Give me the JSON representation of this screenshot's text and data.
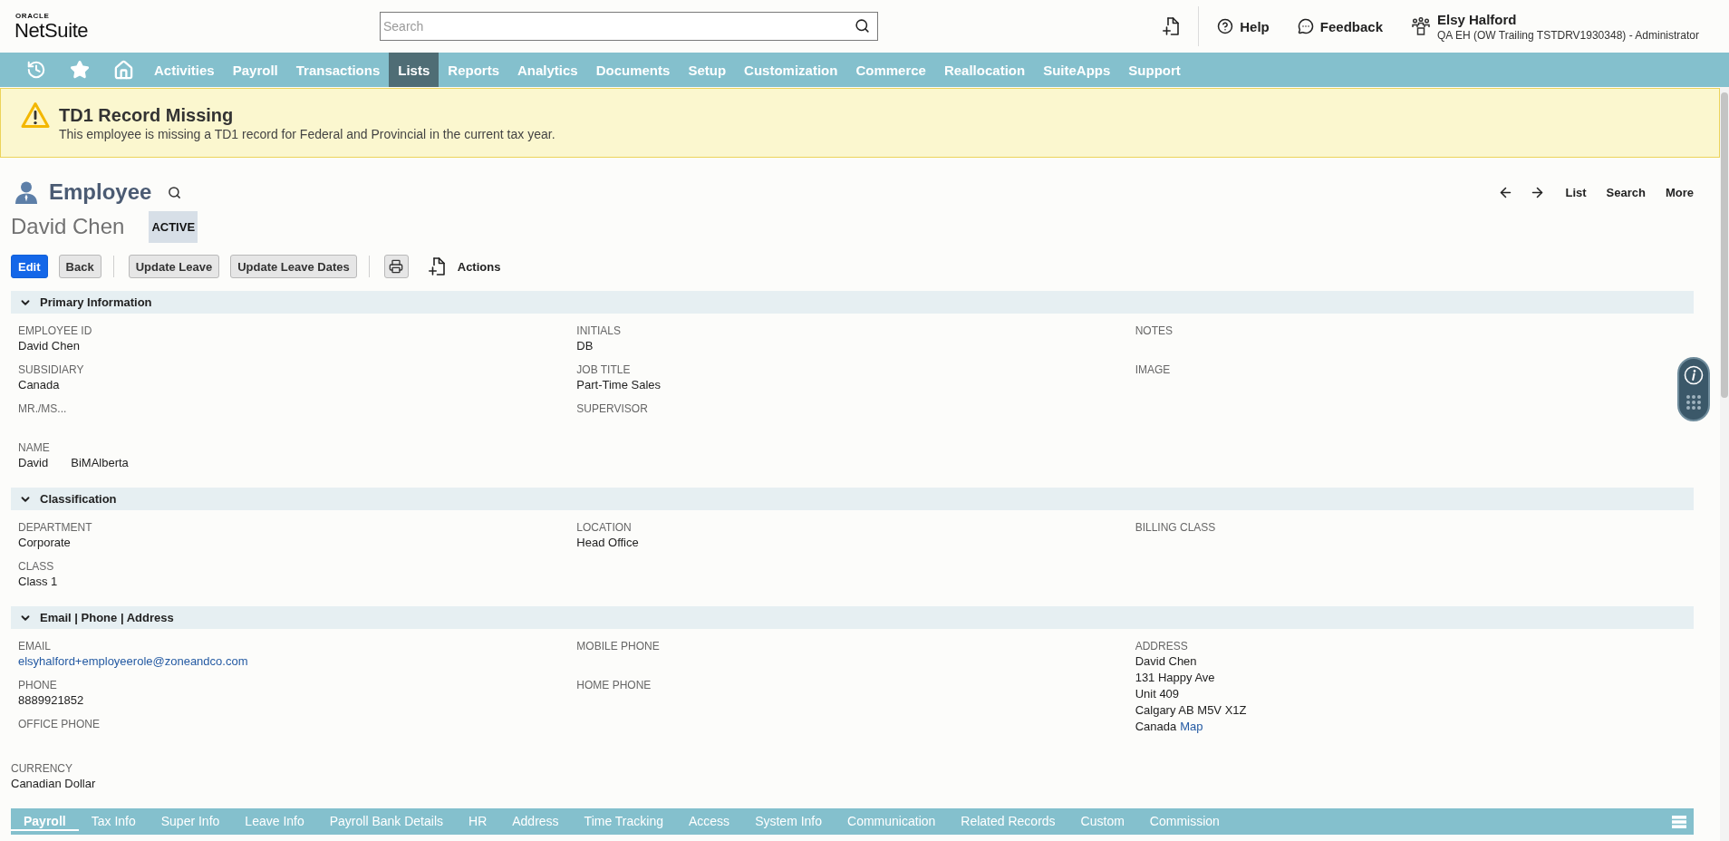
{
  "header": {
    "logo": {
      "caption": "ORACLE",
      "name": "NetSuite"
    },
    "search": {
      "placeholder": "Search"
    },
    "help": "Help",
    "feedback": "Feedback",
    "user": {
      "name": "Elsy Halford",
      "role": "QA EH (OW Trailing TSTDRV1930348) - Administrator"
    }
  },
  "nav": {
    "items": [
      {
        "label": "Activities",
        "selected": false
      },
      {
        "label": "Payroll",
        "selected": false
      },
      {
        "label": "Transactions",
        "selected": false
      },
      {
        "label": "Lists",
        "selected": true
      },
      {
        "label": "Reports",
        "selected": false
      },
      {
        "label": "Analytics",
        "selected": false
      },
      {
        "label": "Documents",
        "selected": false
      },
      {
        "label": "Setup",
        "selected": false
      },
      {
        "label": "Customization",
        "selected": false
      },
      {
        "label": "Commerce",
        "selected": false
      },
      {
        "label": "Reallocation",
        "selected": false
      },
      {
        "label": "SuiteApps",
        "selected": false
      },
      {
        "label": "Support",
        "selected": false
      }
    ]
  },
  "alert": {
    "title": "TD1 Record Missing",
    "message": "This employee is missing a TD1 record for Federal and Provincial in the current tax year."
  },
  "record": {
    "type": "Employee",
    "name": "David Chen",
    "status": "ACTIVE",
    "links": [
      "List",
      "Search",
      "More"
    ]
  },
  "toolbar": [
    {
      "kind": "primary",
      "label": "Edit"
    },
    {
      "kind": "secondary",
      "label": "Back"
    },
    {
      "kind": "divider"
    },
    {
      "kind": "secondary",
      "label": "Update Leave"
    },
    {
      "kind": "secondary",
      "label": "Update Leave Dates"
    },
    {
      "kind": "divider"
    },
    {
      "kind": "print"
    },
    {
      "kind": "new"
    },
    {
      "kind": "menu",
      "label": "Actions"
    }
  ],
  "sections": [
    {
      "title": "Primary Information",
      "expanded": true,
      "columns": [
        [
          {
            "kind": "text",
            "label": "EMPLOYEE ID",
            "value": "David Chen"
          },
          {
            "kind": "text",
            "label": "SUBSIDIARY",
            "value": "Canada"
          },
          {
            "kind": "text",
            "label": "MR./MS..."
          },
          {
            "kind": "parts",
            "label": "NAME",
            "values": [
              "David",
              "BiMAlberta"
            ]
          }
        ],
        [
          {
            "kind": "text",
            "label": "INITIALS",
            "value": "DB"
          },
          {
            "kind": "text",
            "label": "JOB TITLE",
            "value": "Part-Time Sales"
          },
          {
            "kind": "text",
            "label": "SUPERVISOR"
          }
        ],
        [
          {
            "kind": "text",
            "label": "NOTES"
          },
          {
            "kind": "text",
            "label": "IMAGE"
          }
        ]
      ]
    },
    {
      "title": "Classification",
      "expanded": true,
      "columns": [
        [
          {
            "kind": "text",
            "label": "DEPARTMENT",
            "value": "Corporate"
          },
          {
            "kind": "text",
            "label": "CLASS",
            "value": "Class 1"
          }
        ],
        [
          {
            "kind": "text",
            "label": "LOCATION",
            "value": "Head Office"
          }
        ],
        [
          {
            "kind": "text",
            "label": "BILLING CLASS"
          }
        ]
      ]
    },
    {
      "title": "Email | Phone | Address",
      "expanded": true,
      "columns": [
        [
          {
            "kind": "link",
            "label": "EMAIL",
            "value": "elsyhalford+employeerole@zoneandco.com"
          },
          {
            "kind": "text",
            "label": "PHONE",
            "value": "8889921852"
          },
          {
            "kind": "text",
            "label": "OFFICE PHONE"
          }
        ],
        [
          {
            "kind": "text",
            "label": "MOBILE PHONE"
          },
          {
            "kind": "text",
            "label": "HOME PHONE"
          }
        ],
        [
          {
            "kind": "address",
            "label": "ADDRESS",
            "lines": [
              "David Chen",
              "131 Happy Ave",
              "Unit 409",
              "Calgary AB M5V X1Z",
              "Canada"
            ],
            "link": "Map"
          }
        ]
      ]
    }
  ],
  "extra_fields": [
    {
      "kind": "text",
      "label": "CURRENCY",
      "value": "Canadian Dollar"
    }
  ],
  "subtabs": [
    {
      "label": "Payroll",
      "selected": true
    },
    {
      "label": "Tax Info",
      "selected": false
    },
    {
      "label": "Super Info",
      "selected": false
    },
    {
      "label": "Leave Info",
      "selected": false
    },
    {
      "label": "Payroll Bank Details",
      "selected": false
    },
    {
      "label": "HR",
      "selected": false
    },
    {
      "label": "Address",
      "selected": false
    },
    {
      "label": "Time Tracking",
      "selected": false
    },
    {
      "label": "Access",
      "selected": false
    },
    {
      "label": "System Info",
      "selected": false
    },
    {
      "label": "Communication",
      "selected": false
    },
    {
      "label": "Related Records",
      "selected": false
    },
    {
      "label": "Custom",
      "selected": false
    },
    {
      "label": "Commission",
      "selected": false
    }
  ]
}
